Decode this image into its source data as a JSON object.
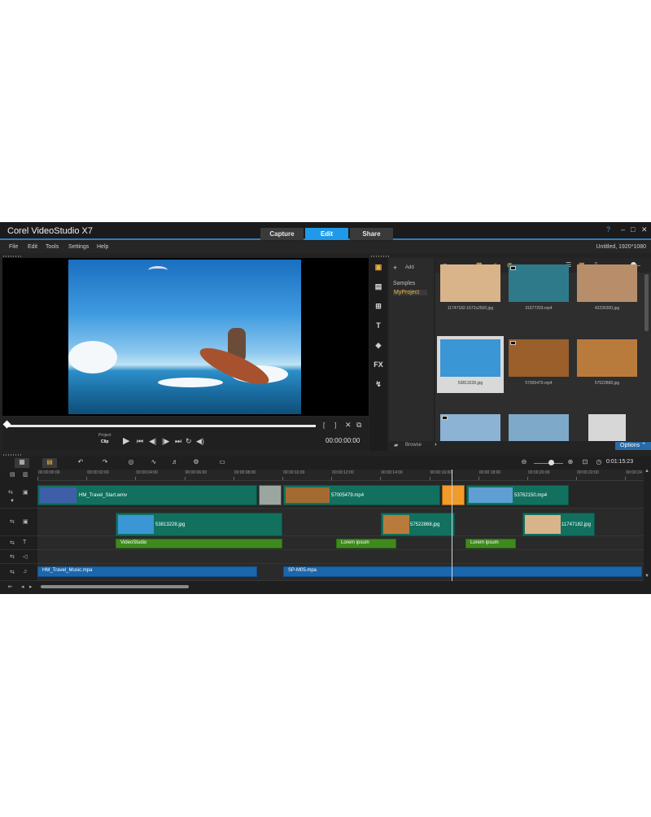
{
  "app": {
    "title": "Corel VideoStudio X7",
    "tabs": [
      {
        "label": "Capture"
      },
      {
        "label": "Edit"
      },
      {
        "label": "Share"
      }
    ],
    "active_tab": "Edit",
    "window_controls": {
      "help": "?",
      "minimize": "–",
      "maximize": "□",
      "close": "✕"
    },
    "accent_color": "#1e9ae8"
  },
  "menu": {
    "items": [
      "File",
      "Edit",
      "Tools",
      "Settings",
      "Help"
    ],
    "project_info": "Untitled, 1920*1080"
  },
  "player": {
    "project_label": "Project",
    "clip_label": "Clip",
    "timecode": "00:00:00:00",
    "icons": [
      "play-icon",
      "home-icon",
      "prev-frame-icon",
      "next-frame-icon",
      "end-icon",
      "repeat-icon",
      "volume-icon",
      "mark-in-icon",
      "mark-out-icon",
      "split-icon",
      "enlarge-icon"
    ]
  },
  "library": {
    "add_label": "Add",
    "folders": [
      "Samples",
      "MyProject"
    ],
    "selected_folder": "MyProject",
    "browse_label": "Browse",
    "options_label": "Options",
    "tools": [
      "media-icon",
      "instant-project-icon",
      "transition-icon",
      "title-icon",
      "graphic-icon",
      "FX",
      "path-icon"
    ],
    "thumbnails": [
      {
        "caption": "11747182-1672x2500.jpg",
        "color": "#d9b48a",
        "badge": ""
      },
      {
        "caption": "31677203.mp4",
        "color": "#2f7a8a",
        "badge": "video"
      },
      {
        "caption": "42236300.jpg",
        "color": "#b88e6a",
        "badge": ""
      },
      {
        "caption": "53813228.jpg",
        "color": "#3a96d4",
        "badge": "",
        "selected": true
      },
      {
        "caption": "57005479.mp4",
        "color": "#9a5f2a",
        "badge": "video"
      },
      {
        "caption": "57522868.jpg",
        "color": "#b97b3c",
        "badge": ""
      },
      {
        "caption": "",
        "color": "#8cb3d4",
        "badge": "video"
      },
      {
        "caption": "",
        "color": "#7fa9c9",
        "badge": ""
      },
      {
        "caption": "",
        "color": "#d7d7d7",
        "badge": ""
      }
    ]
  },
  "timeline": {
    "timecode": "0:01:15:23",
    "ruler": [
      "00:00:00:00",
      "00:00:02:00",
      "00:00:04:00",
      "00:00:06:00",
      "00:00:08:00",
      "00:00:10:00",
      "00:00:12:00",
      "00:00:14:00",
      "00:00:16:00",
      "00:00:18:00",
      "00:00:20:00",
      "00:00:22:00",
      "00:00:24"
    ],
    "video_track": [
      {
        "label": "HM_Travel_Start.wmv",
        "color": "#12705f"
      },
      {
        "label": "57005479.mp4",
        "color": "#12705f"
      },
      {
        "label": "53762150.mp4",
        "color": "#12705f"
      }
    ],
    "overlay_track": [
      {
        "label": "53813228.jpg"
      },
      {
        "label": "57522868.jpg"
      },
      {
        "label": "11747182.jpg"
      }
    ],
    "title_track": [
      {
        "label": "VideoStudio"
      },
      {
        "label": "Lorem ipsum"
      },
      {
        "label": "Lorem ipsum"
      }
    ],
    "music_track": [
      {
        "label": "HM_Travel_Music.mpa"
      },
      {
        "label": "SP-M05.mpa"
      }
    ]
  }
}
